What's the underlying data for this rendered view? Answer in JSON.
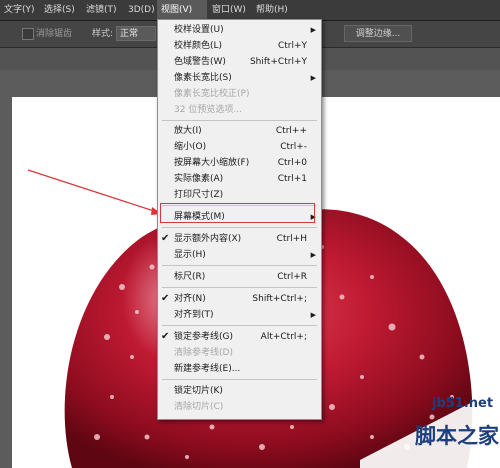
{
  "menubar": {
    "items": [
      "文字(Y)",
      "选择(S)",
      "滤镜(T)",
      "3D(D)",
      "视图(V)",
      "窗口(W)",
      "帮助(H)"
    ]
  },
  "optionsbar": {
    "antialias_label": "消除锯齿",
    "style_label": "样式:",
    "style_value": "正常",
    "refine_edge_label": "调整边缘..."
  },
  "view_menu": {
    "items": [
      {
        "label": "校样设置(U)",
        "shortcut": "",
        "submenu": true
      },
      {
        "label": "校样颜色(L)",
        "shortcut": "Ctrl+Y"
      },
      {
        "label": "色域警告(W)",
        "shortcut": "Shift+Ctrl+Y"
      },
      {
        "label": "像素长宽比(S)",
        "shortcut": "",
        "submenu": true
      },
      {
        "label": "像素长宽比校正(P)",
        "shortcut": "",
        "disabled": true
      },
      {
        "label": "32 位预览选项...",
        "shortcut": "",
        "disabled": true
      },
      {
        "label": "放大(I)",
        "shortcut": "Ctrl++"
      },
      {
        "label": "缩小(O)",
        "shortcut": "Ctrl+-"
      },
      {
        "label": "按屏幕大小缩放(F)",
        "shortcut": "Ctrl+0"
      },
      {
        "label": "实际像素(A)",
        "shortcut": "Ctrl+1"
      },
      {
        "label": "打印尺寸(Z)",
        "shortcut": ""
      },
      {
        "label": "屏幕模式(M)",
        "shortcut": "",
        "submenu": true
      },
      {
        "label": "显示额外内容(X)",
        "shortcut": "Ctrl+H",
        "checked": true
      },
      {
        "label": "显示(H)",
        "shortcut": "",
        "submenu": true
      },
      {
        "label": "标尺(R)",
        "shortcut": "Ctrl+R"
      },
      {
        "label": "对齐(N)",
        "shortcut": "Shift+Ctrl+;",
        "checked": true
      },
      {
        "label": "对齐到(T)",
        "shortcut": "",
        "submenu": true
      },
      {
        "label": "锁定参考线(G)",
        "shortcut": "Alt+Ctrl+;",
        "checked": true
      },
      {
        "label": "清除参考线(D)",
        "shortcut": "",
        "disabled": true
      },
      {
        "label": "新建参考线(E)...",
        "shortcut": ""
      },
      {
        "label": "锁定切片(K)",
        "shortcut": ""
      },
      {
        "label": "清除切片(C)",
        "shortcut": "",
        "disabled": true
      }
    ]
  },
  "watermark": {
    "domain": "jb51.net",
    "name": "脚本之家"
  },
  "colors": {
    "annotation_red": "#d9383a",
    "apple_red": "#b3122a",
    "menu_bg": "#f0f0f0"
  }
}
